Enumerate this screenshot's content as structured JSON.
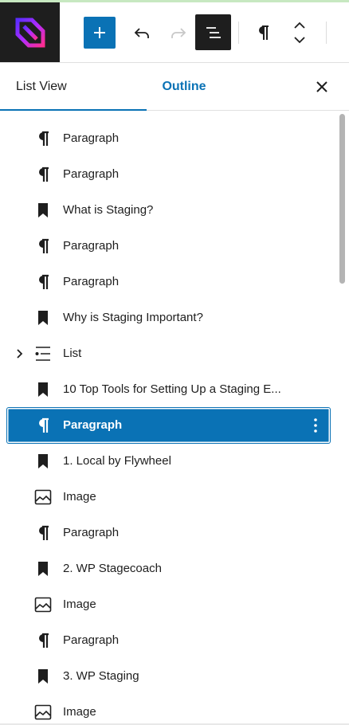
{
  "toolbar": {
    "add_label": "Add block",
    "undo_label": "Undo",
    "redo_label": "Redo",
    "listview_label": "Document Overview",
    "block_type_label": "Paragraph",
    "move_label": "Move"
  },
  "tabs": {
    "list_view": "List View",
    "outline": "Outline"
  },
  "list": {
    "items": [
      {
        "type": "paragraph",
        "label": "Paragraph"
      },
      {
        "type": "paragraph",
        "label": "Paragraph"
      },
      {
        "type": "heading",
        "label": "What is Staging?"
      },
      {
        "type": "paragraph",
        "label": "Paragraph"
      },
      {
        "type": "paragraph",
        "label": "Paragraph"
      },
      {
        "type": "heading",
        "label": "Why is Staging Important?"
      },
      {
        "type": "list",
        "label": "List",
        "expandable": true
      },
      {
        "type": "heading",
        "label": "10 Top Tools for Setting Up a Staging E..."
      },
      {
        "type": "paragraph",
        "label": "Paragraph",
        "selected": true
      },
      {
        "type": "heading",
        "label": "1. Local by Flywheel"
      },
      {
        "type": "image",
        "label": "Image"
      },
      {
        "type": "paragraph",
        "label": "Paragraph"
      },
      {
        "type": "heading",
        "label": "2. WP Stagecoach"
      },
      {
        "type": "image",
        "label": "Image"
      },
      {
        "type": "paragraph",
        "label": "Paragraph"
      },
      {
        "type": "heading",
        "label": "3. WP Staging"
      },
      {
        "type": "image",
        "label": "Image"
      }
    ]
  },
  "colors": {
    "accent": "#0a72b5",
    "dark": "#1e1e1e",
    "logo_gradient_start": "#6a2cff",
    "logo_gradient_end": "#ff2d8f"
  },
  "icons": {
    "paragraph": "pilcrow-icon",
    "heading": "bookmark-icon",
    "list": "list-icon",
    "image": "image-icon"
  }
}
